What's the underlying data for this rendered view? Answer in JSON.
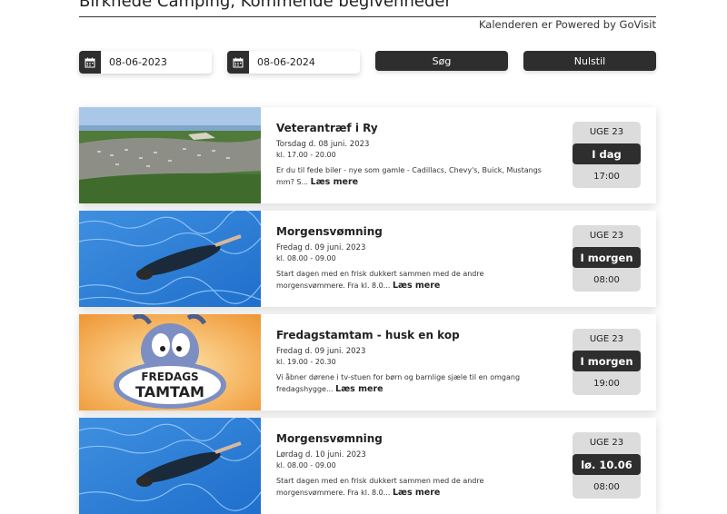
{
  "header": {
    "title": "Birknede Camping, Kommende begivenheder",
    "powered_by": "Kalenderen er Powered by GoVisit"
  },
  "filters": {
    "from_date": "08-06-2023",
    "to_date": "08-06-2024",
    "search_label": "Søg",
    "reset_label": "Nulstil"
  },
  "events": [
    {
      "title": "Veterantræf i Ry",
      "date": "Torsdag d. 08 juni. 2023",
      "time": "kl. 17.00 - 20.00",
      "desc": "Er du til fede biler - nye som gamle - Cadillacs, Chevy's, Buick, Mustangs mm? S...",
      "more": "Læs mere",
      "week": "UGE 23",
      "day": "I dag",
      "clock": "17:00",
      "image": "aerial-car-meet-image"
    },
    {
      "title": "Morgensvømning",
      "date": "Fredag d. 09 juni. 2023",
      "time": "kl. 08.00 - 09.00",
      "desc": "Start dagen med en frisk dukkert sammen med de andre morgensvømmere. Fra kl. 8.0...",
      "more": "Læs mere",
      "week": "UGE 23",
      "day": "I morgen",
      "clock": "08:00",
      "image": "swimmer-pool-image"
    },
    {
      "title": "Fredagstamtam - husk en kop",
      "date": "Fredag d. 09 juni. 2023",
      "time": "kl. 19.00 - 20.30",
      "desc": "Vi åbner dørene i tv-stuen for børn og barnlige sjæle til en omgang fredagshygge...",
      "more": "Læs mere",
      "week": "UGE 23",
      "day": "I morgen",
      "clock": "19:00",
      "image": "fredags-tamtam-cartoon-image",
      "image_text": "FREDAGS TAMTAM"
    },
    {
      "title": "Morgensvømning",
      "date": "Lørdag d. 10 juni. 2023",
      "time": "kl. 08.00 - 09.00",
      "desc": "Start dagen med en frisk dukkert sammen med de andre morgensvømmere. Fra kl. 8.0...",
      "more": "Læs mere",
      "week": "UGE 23",
      "day": "lø. 10.06",
      "clock": "08:00",
      "image": "swimmer-pool-image"
    }
  ]
}
